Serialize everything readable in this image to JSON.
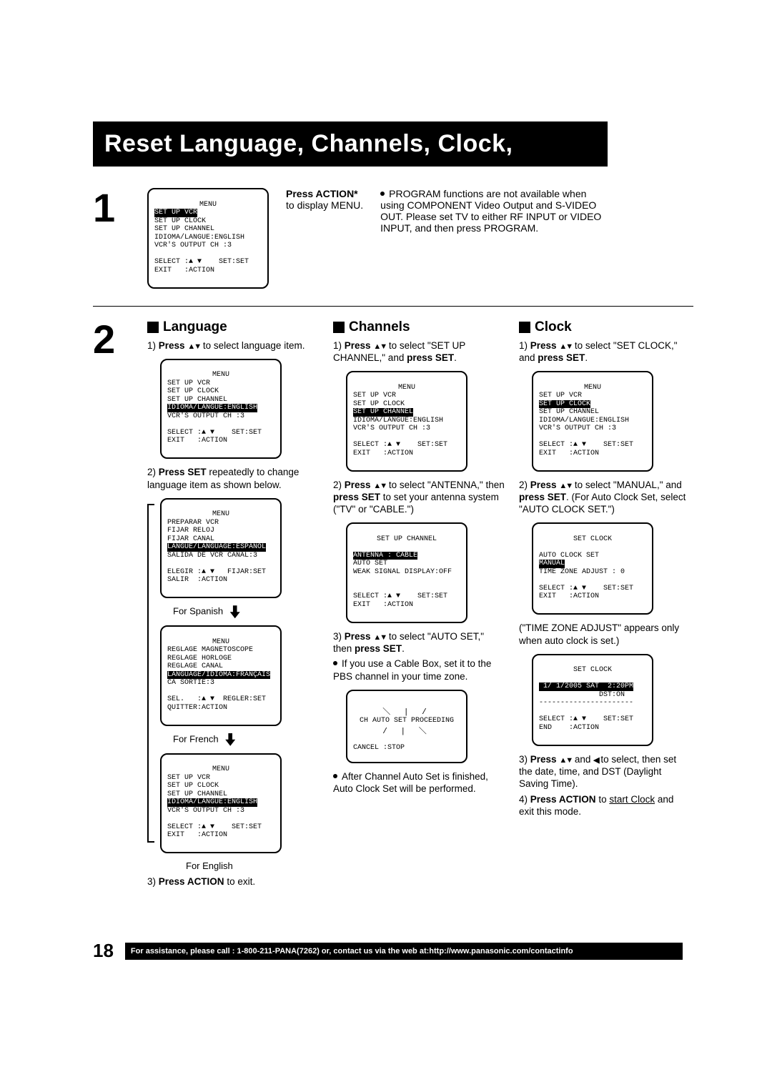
{
  "title": "Reset Language, Channels, Clock,",
  "step_one": {
    "num": "1",
    "instruction_bold": "Press ACTION*",
    "instruction_rest": "to display MENU.",
    "note": "PROGRAM functions are not available when using COMPONENT Video Output and S-VIDEO OUT. Please set TV to either RF INPUT or VIDEO INPUT, and then press PROGRAM.",
    "screen": {
      "title": "MENU",
      "l1": "SET UP VCR",
      "l2": "SET UP CLOCK",
      "l3": "SET UP CHANNEL",
      "l4": "IDIOMA/LANGUE:ENGLISH",
      "l5": "VCR'S OUTPUT CH :3",
      "f1": "SELECT :▲ ▼    SET:SET",
      "f2": "EXIT   :ACTION"
    }
  },
  "step_two": {
    "num": "2",
    "language": {
      "heading": "Language",
      "s1a": "1)",
      "s1b": "Press ",
      "s1c": " to select language item.",
      "s2a": "2)",
      "s2b": "Press SET",
      "s2c": " repeatedly to change language item as shown below.",
      "cap_es": "For Spanish",
      "cap_fr": "For French",
      "cap_en": "For English",
      "s3a": "3)",
      "s3b": "Press ACTION",
      "s3c": " to exit.",
      "screen_en": {
        "title": "MENU",
        "l1": "SET UP VCR",
        "l2": "SET UP CLOCK",
        "l3": "SET UP CHANNEL",
        "l4": "IDIOMA/LANGUE:ENGLISH",
        "l5": "VCR'S OUTPUT CH :3",
        "f1": "SELECT :▲ ▼    SET:SET",
        "f2": "EXIT   :ACTION"
      },
      "screen_es": {
        "title": "MENU",
        "l1": "PREPARAR VCR",
        "l2": "FIJAR RELOJ",
        "l3": "FIJAR CANAL",
        "l4": "LANGUE/LANGUAGE:ESPAÑOL",
        "l5": "SALIDA DE VCR CANAL:3",
        "f1": "ELEGIR :▲ ▼   FIJAR:SET",
        "f2": "SALIR  :ACTION"
      },
      "screen_fr": {
        "title": "MENU",
        "l1": "REGLAGE MAGNETOSCOPE",
        "l2": "REGLAGE HORLOGE",
        "l3": "REGLAGE CANAL",
        "l4": "LANGUAGE/IDIOMA:FRANÇAIS",
        "l5": "CA SORTIE:3",
        "f1": "SEL.   :▲ ▼  REGLER:SET",
        "f2": "QUITTER:ACTION"
      }
    },
    "channels": {
      "heading": "Channels",
      "s1a": "1)",
      "s1b": "Press ",
      "s1c": " to select \"SET UP CHANNEL,\" and ",
      "s1d": "press SET",
      "s1e": ".",
      "s2a": "2)",
      "s2b": "Press ",
      "s2c": " to select \"ANTENNA,\" then ",
      "s2d": "press SET",
      "s2e": " to set your antenna system (\"TV\" or \"CABLE.\")",
      "s3a": "3)",
      "s3b": "Press ",
      "s3c": " to select \"AUTO SET,\" then ",
      "s3d": "press SET",
      "s3e": ".",
      "bul1": "If you use a Cable Box, set it to the PBS channel in your time zone.",
      "bul2": "After Channel Auto Set is finished, Auto Clock Set will be performed.",
      "screen_menu": {
        "title": "MENU",
        "l1": "SET UP VCR",
        "l2": "SET UP CLOCK",
        "l3": "SET UP CHANNEL",
        "l4": "IDIOMA/LANGUE:ENGLISH",
        "l5": "VCR'S OUTPUT CH :3",
        "f1": "SELECT :▲ ▼    SET:SET",
        "f2": "EXIT   :ACTION"
      },
      "screen_ch": {
        "title": "SET UP CHANNEL",
        "l1": "ANTENNA : CABLE",
        "l2": "AUTO SET",
        "l3": "WEAK SIGNAL DISPLAY:OFF",
        "f1": "SELECT :▲ ▼    SET:SET",
        "f2": "EXIT   :ACTION"
      },
      "screen_auto": {
        "l1": "CH AUTO SET PROCEEDING",
        "l2": "CANCEL :STOP"
      }
    },
    "clock": {
      "heading": "Clock",
      "s1a": "1)",
      "s1b": "Press ",
      "s1c": " to select \"SET CLOCK,\" and ",
      "s1d": "press SET",
      "s1e": ".",
      "s2a": "2)",
      "s2b": "Press ",
      "s2c": " to select \"MANUAL,\" and ",
      "s2d": "press SET",
      "s2e": ". (For Auto Clock Set, select \"AUTO CLOCK SET.\")",
      "tza_note": "(\"TIME ZONE ADJUST\" appears only when auto clock is set.)",
      "s3a": "3)",
      "s3b": "Press ",
      "s3c": " and ",
      "s3d": " to select, then set the date, time, and DST (Daylight Saving Time).",
      "s4a": "4)",
      "s4b": "Press ACTION",
      "s4c": " to ",
      "s4d": "start Clock",
      "s4e": " and exit this mode.",
      "screen_menu": {
        "title": "MENU",
        "l1": "SET UP VCR",
        "l2": "SET UP CLOCK",
        "l3": "SET UP CHANNEL",
        "l4": "IDIOMA/LANGUE:ENGLISH",
        "l5": "VCR'S OUTPUT CH :3",
        "f1": "SELECT :▲ ▼    SET:SET",
        "f2": "EXIT   :ACTION"
      },
      "screen_set": {
        "title": "SET CLOCK",
        "l1": "AUTO CLOCK SET",
        "l2": "MANUAL",
        "l3": "TIME ZONE ADJUST : 0",
        "f1": "SELECT :▲ ▼    SET:SET",
        "f2": "EXIT   :ACTION"
      },
      "screen_date": {
        "title": "SET CLOCK",
        "l1": " 1/ 1/2005 SAT  2:20PM",
        "l2": "              DST:ON",
        "l3": "----------------------",
        "f1": "SELECT :▲ ▼    SET:SET",
        "f2": "END    :ACTION"
      }
    }
  },
  "footer": {
    "page": "18",
    "text": "For assistance, please call : 1-800-211-PANA(7262) or, contact us via the web at:http://www.panasonic.com/contactinfo"
  }
}
